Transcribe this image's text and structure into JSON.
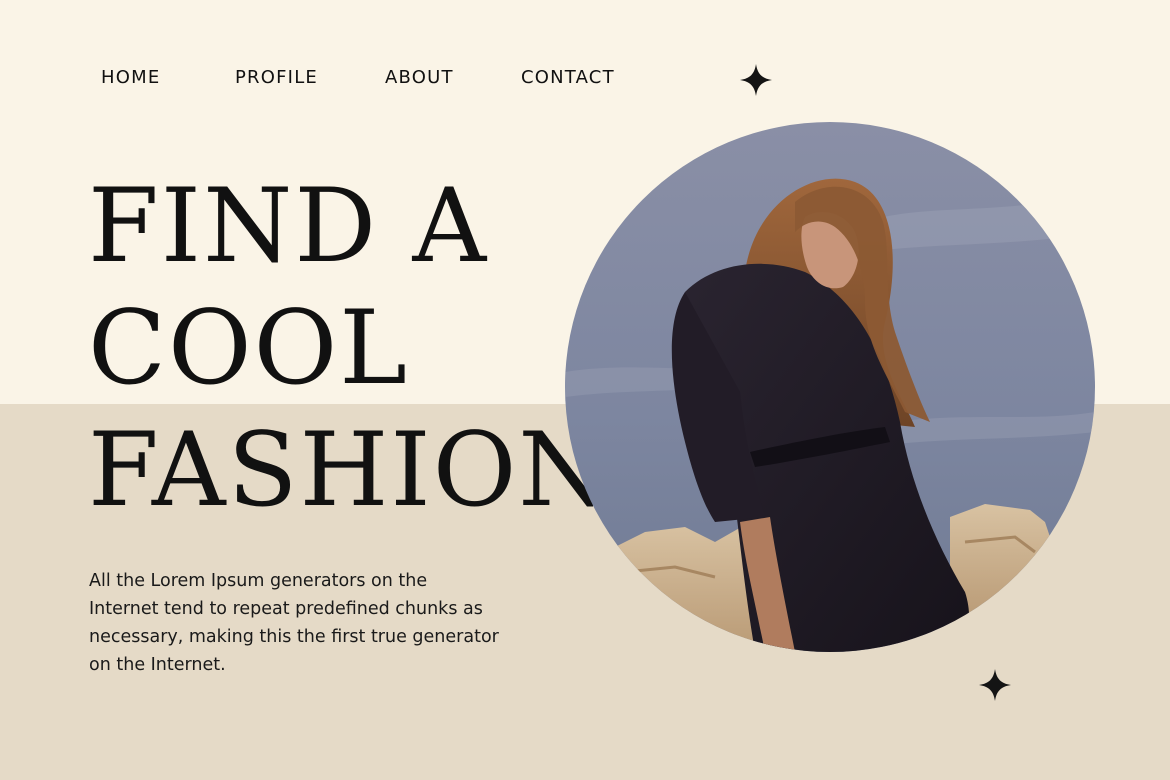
{
  "nav": {
    "items": [
      {
        "label": "HOME"
      },
      {
        "label": "PROFILE"
      },
      {
        "label": "ABOUT"
      },
      {
        "label": "CONTACT"
      }
    ]
  },
  "hero": {
    "headline_lines": [
      "FIND A",
      "COOL",
      "FASHION"
    ],
    "body": "All the Lorem Ipsum generators on the Internet tend to repeat predefined chunks as necessary, making this the first true generator on the Internet."
  },
  "decor": {
    "icons": [
      "sparkle-icon",
      "sparkle-icon"
    ]
  },
  "colors": {
    "background_top": "#faf4e7",
    "background_bottom": "#e5dac7",
    "text": "#111111",
    "accent": "#141414"
  }
}
